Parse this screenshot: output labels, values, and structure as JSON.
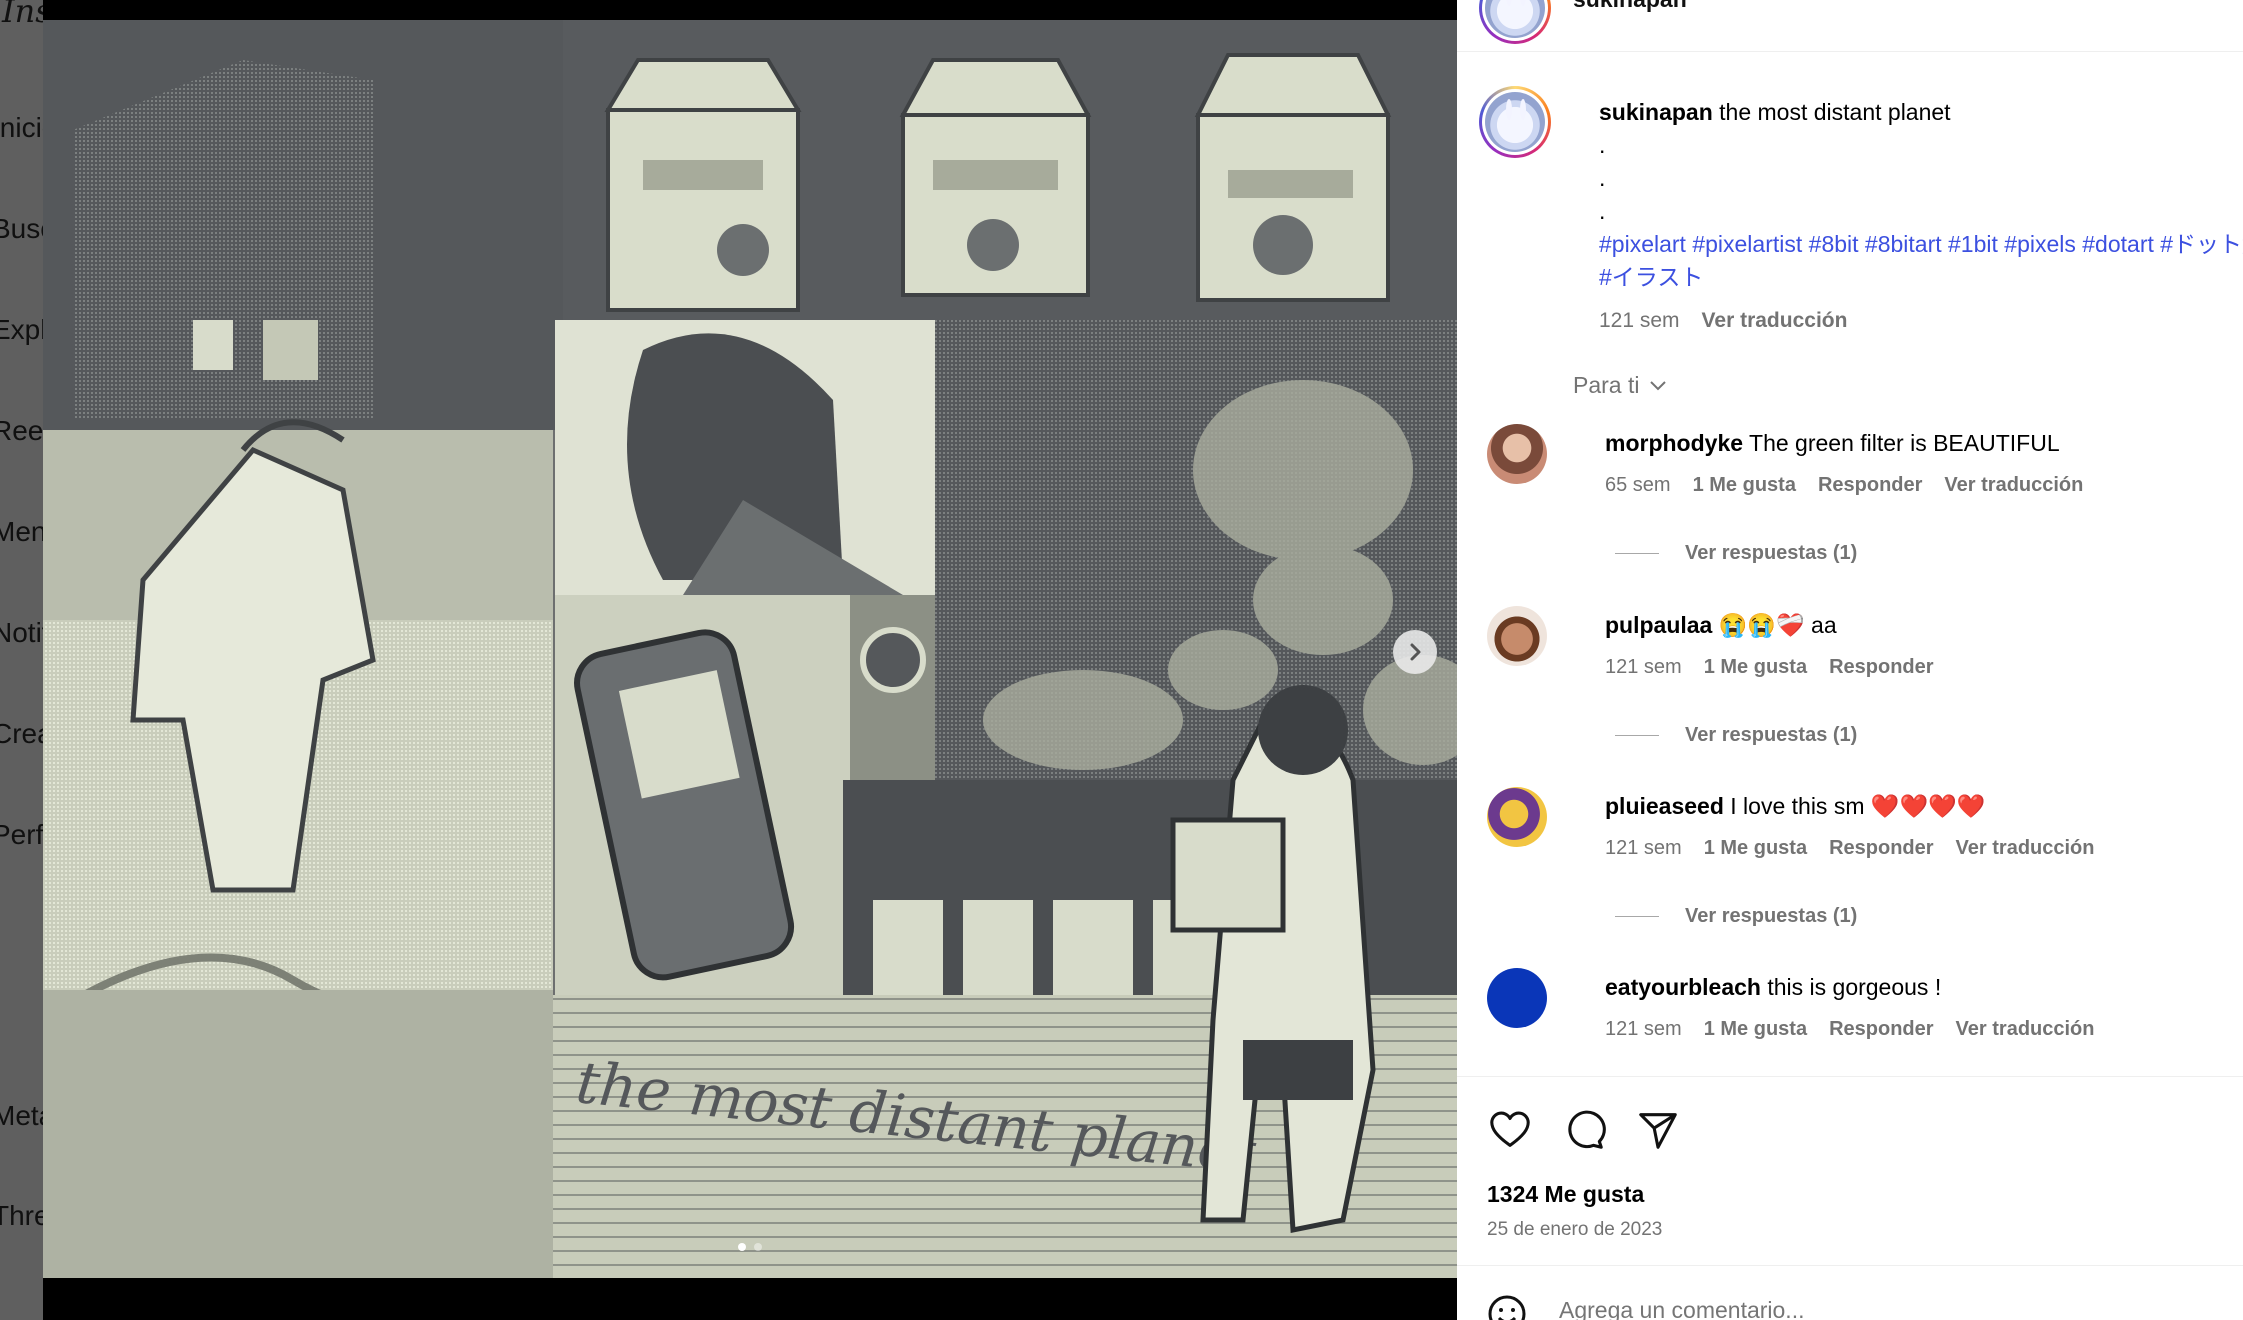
{
  "sidebar": {
    "logo": "Ins",
    "items": [
      {
        "label": "Inicio",
        "icon": "home-icon"
      },
      {
        "label": "Buscar",
        "icon": "search-icon"
      },
      {
        "label": "Explorar",
        "icon": "explore-icon"
      },
      {
        "label": "Reels",
        "icon": "reels-icon"
      },
      {
        "label": "Mensajes",
        "icon": "messages-icon"
      },
      {
        "label": "Notificaciones",
        "icon": "heart-icon"
      },
      {
        "label": "Crear",
        "icon": "create-icon"
      },
      {
        "label": "Perfil",
        "icon": "profile-icon"
      },
      {
        "label": "Meta AI",
        "icon": "meta-ai-icon"
      },
      {
        "label": "Threads",
        "icon": "threads-icon"
      }
    ]
  },
  "post": {
    "author": "sukinapan",
    "carousel": {
      "total": 2,
      "active": 1
    },
    "image_text": "the most distant planet",
    "caption": {
      "text": "the most distant planet",
      "dots": [
        ".",
        ".",
        "."
      ],
      "hashtags": "#pixelart #pixelartist #8bit #8bitart #1bit #pixels #dotart #ドット絵",
      "hashtags_line2": "#イラスト",
      "time": "121 sem",
      "translate": "Ver traducción"
    },
    "for_you": "Para ti",
    "comments": [
      {
        "user": "morphodyke",
        "text": "The green filter is BEAUTIFUL",
        "time": "65 sem",
        "likes": "1 Me gusta",
        "reply": "Responder",
        "translate": "Ver traducción",
        "replies": "Ver respuestas (1)"
      },
      {
        "user": "pulpaulaa",
        "text": "😭😭❤️‍🩹 aa",
        "time": "121 sem",
        "likes": "1 Me gusta",
        "reply": "Responder",
        "translate": "",
        "replies": "Ver respuestas (1)"
      },
      {
        "user": "pluieaseed",
        "text": "I love this sm ❤️❤️❤️❤️",
        "time": "121 sem",
        "likes": "1 Me gusta",
        "reply": "Responder",
        "translate": "Ver traducción",
        "replies": "Ver respuestas (1)"
      },
      {
        "user": "eatyourbleach",
        "text": "this is gorgeous !",
        "time": "121 sem",
        "likes": "1 Me gusta",
        "reply": "Responder",
        "translate": "Ver traducción",
        "replies": ""
      }
    ],
    "likes_count": "1324 Me gusta",
    "date": "25 de enero de 2023",
    "comment_placeholder": "Agrega un comentario..."
  },
  "colors": {
    "hashtag": "#3c50e0",
    "muted": "#737373",
    "image_dark": "#55585b",
    "image_light": "#d8dccb"
  }
}
